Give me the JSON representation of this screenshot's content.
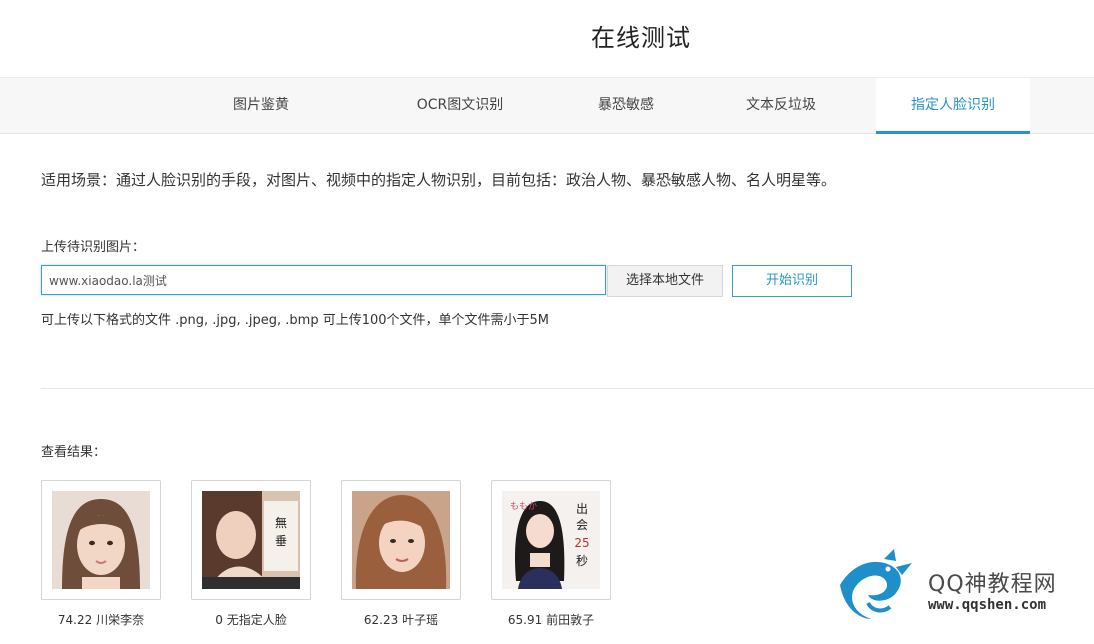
{
  "header": {
    "title": "在线测试"
  },
  "tabs": [
    {
      "label": "图片鉴黄"
    },
    {
      "label": "OCR图文识别"
    },
    {
      "label": "暴恐敏感"
    },
    {
      "label": "文本反垃圾"
    },
    {
      "label": "指定人脸识别",
      "active": true
    }
  ],
  "main": {
    "description": "适用场景：通过人脸识别的手段，对图片、视频中的指定人物识别，目前包括：政治人物、暴恐敏感人物、名人明星等。",
    "upload_label": "上传待识别图片：",
    "url_value": "www.xiaodao.la测试",
    "choose_file_label": "选择本地文件",
    "start_label": "开始识别",
    "hint": "可上传以下格式的文件 .png, .jpg, .jpeg, .bmp 可上传100个文件，单个文件需小于5M"
  },
  "results": {
    "label": "查看结果：",
    "items": [
      {
        "caption": "74.22 川栄李奈"
      },
      {
        "caption": "0 无指定人脸"
      },
      {
        "caption": "62.23 叶子瑶"
      },
      {
        "caption": "65.91 前田敦子"
      }
    ]
  },
  "watermark": {
    "name": "QQ神教程网",
    "url": "www.qqshen.com"
  },
  "colors": {
    "accent": "#2a93c9",
    "tabbar_bg": "#f7f7f7"
  }
}
